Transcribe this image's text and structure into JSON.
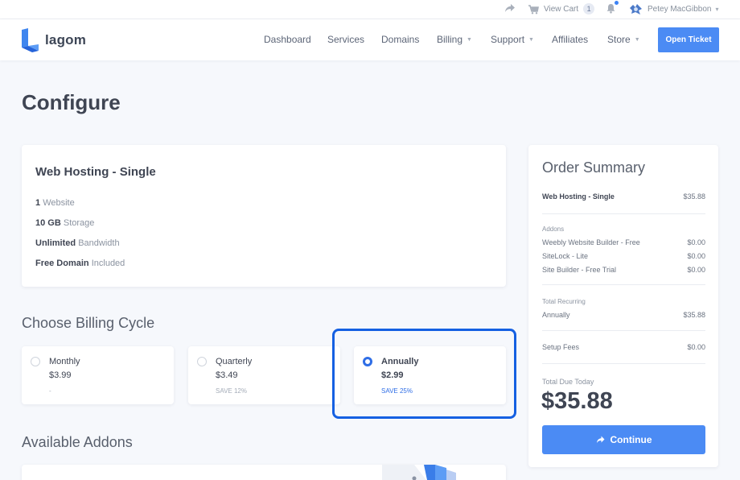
{
  "topbar": {
    "view_cart_label": "View Cart",
    "cart_count": "1",
    "user_name": "Petey MacGibbon"
  },
  "brand": {
    "logo_text": "lagom",
    "accent": "#4b8bf4"
  },
  "nav": {
    "items": [
      {
        "label": "Dashboard"
      },
      {
        "label": "Services"
      },
      {
        "label": "Domains"
      },
      {
        "label": "Billing"
      },
      {
        "label": "Support"
      },
      {
        "label": "Affiliates"
      },
      {
        "label": "Store"
      }
    ],
    "open_ticket": "Open Ticket"
  },
  "page": {
    "title": "Configure"
  },
  "product": {
    "name": "Web Hosting - Single",
    "features": [
      {
        "value": "1",
        "text": "Website"
      },
      {
        "value": "10 GB",
        "text": "Storage"
      },
      {
        "value": "Unlimited",
        "text": "Bandwidth"
      },
      {
        "value": "Free Domain",
        "text": "Included"
      }
    ]
  },
  "billing": {
    "title": "Choose Billing Cycle",
    "options": [
      {
        "name": "Monthly",
        "price": "$3.99",
        "note": "-",
        "selected": false
      },
      {
        "name": "Quarterly",
        "price": "$3.49",
        "note": "SAVE 12%",
        "selected": false
      },
      {
        "name": "Annually",
        "price": "$2.99",
        "note": "SAVE 25%",
        "selected": true
      }
    ]
  },
  "addons": {
    "title": "Available Addons"
  },
  "summary": {
    "title": "Order Summary",
    "product_name": "Web Hosting - Single",
    "product_price": "$35.88",
    "addons_label": "Addons",
    "addons": [
      {
        "name": "Weebly Website Builder - Free",
        "price": "$0.00"
      },
      {
        "name": "SiteLock - Lite",
        "price": "$0.00"
      },
      {
        "name": "Site Builder - Free Trial",
        "price": "$0.00"
      }
    ],
    "recurring_label": "Total Recurring",
    "recurring_cycle": "Annually",
    "recurring_price": "$35.88",
    "setup_label": "Setup Fees",
    "setup_price": "$0.00",
    "due_label": "Total Due Today",
    "due_amount": "$35.88",
    "continue_label": "Continue"
  }
}
